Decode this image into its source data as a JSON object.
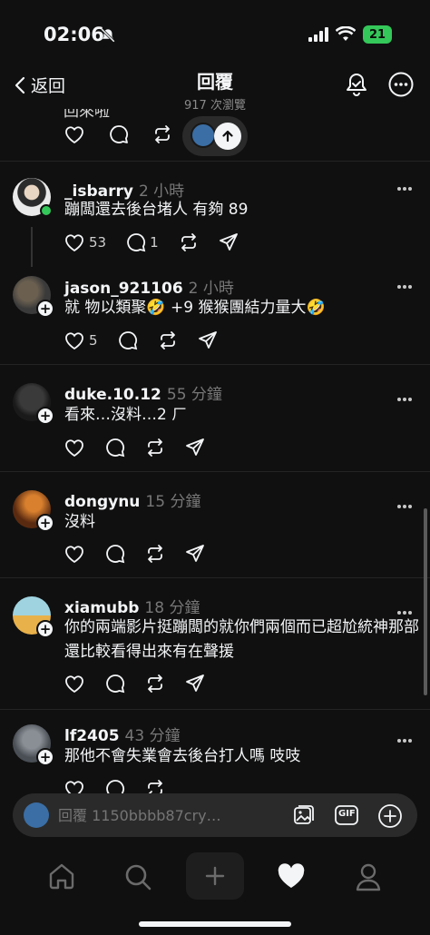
{
  "status": {
    "time": "02:06",
    "battery": "21"
  },
  "header": {
    "back_label": "返回",
    "title": "回覆",
    "views": "917 次瀏覽"
  },
  "partial": {
    "text": "回來啦"
  },
  "comments": [
    {
      "username": "_isbarry",
      "ago": "2 小時",
      "text": "蹦闆還去後台堵人 有夠 89",
      "likes": "53",
      "replies": "1"
    },
    {
      "username": "jason_921106",
      "ago": "2 小時",
      "text": "就 物以類聚🤣 +9 猴猴團結力量大🤣",
      "likes": "5",
      "replies": ""
    },
    {
      "username": "duke.10.12",
      "ago": "55 分鐘",
      "text": "看來…沒料…2 ㄏ",
      "likes": "",
      "replies": ""
    },
    {
      "username": "dongynu",
      "ago": "15 分鐘",
      "text": "沒料",
      "likes": "",
      "replies": ""
    },
    {
      "username": "xiamubb",
      "ago": "18 分鐘",
      "text": "你的兩端影片挺蹦闆的就你們兩個而已超尬統神那部還比較看得出來有在聲援",
      "likes": "",
      "replies": ""
    },
    {
      "username": "lf2405",
      "ago": "43 分鐘",
      "text": "那他不會失業會去後台打人嗎 吱吱",
      "likes": "",
      "replies": ""
    }
  ],
  "reply_bar": {
    "placeholder": "回覆 1150bbbb87cry…",
    "gif_label": "GIF"
  },
  "colors": {
    "background": "#101010",
    "text": "#f3f5f7",
    "muted": "#777777",
    "online": "#34c759"
  }
}
